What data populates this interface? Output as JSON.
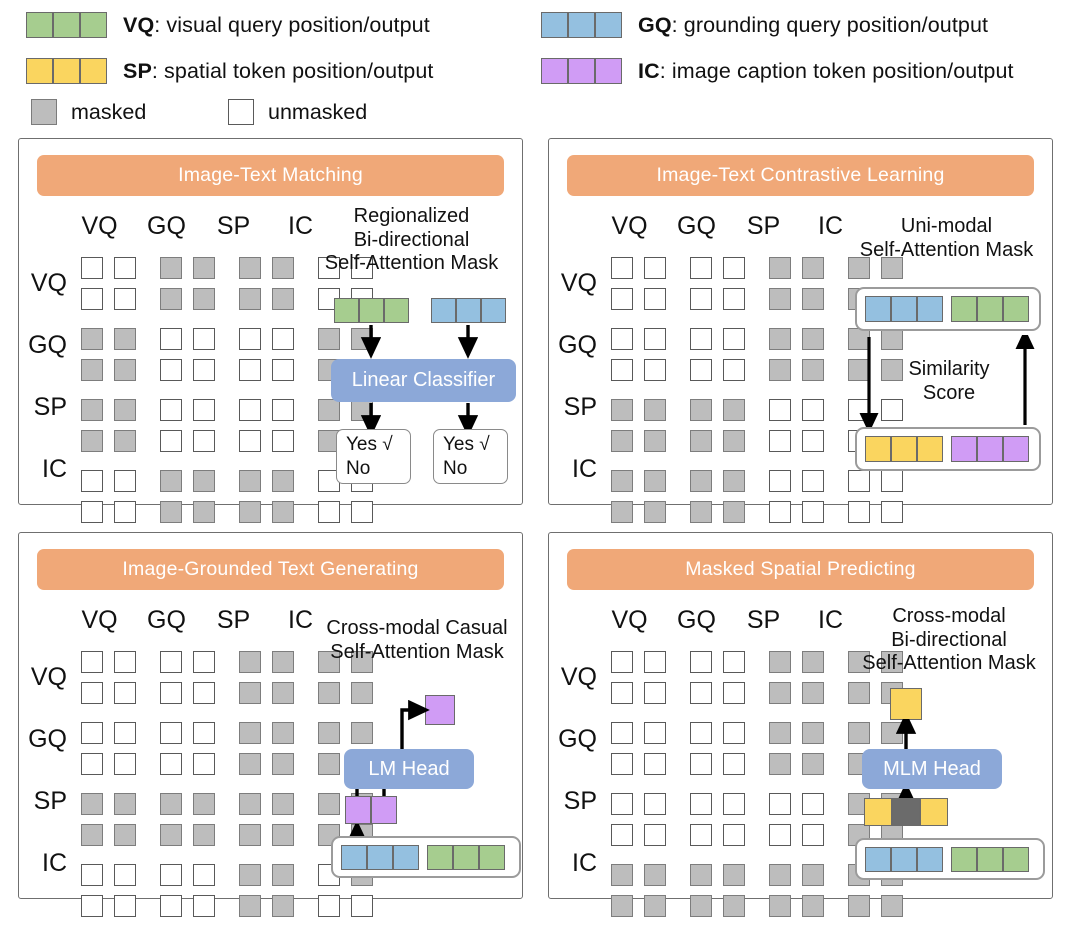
{
  "legend": {
    "entries": [
      {
        "code": "VQ",
        "desc": ": visual query position/output",
        "color": "#a6cd8f"
      },
      {
        "code": "GQ",
        "desc": ": grounding query position/output",
        "color": "#94c0e0"
      },
      {
        "code": "SP",
        "desc": ": spatial token position/output",
        "color": "#fad55f"
      },
      {
        "code": "IC",
        "desc": ": image caption token position/output",
        "color": "#d09cf5"
      }
    ],
    "masked_label": "masked",
    "unmasked_label": "unmasked"
  },
  "colors": {
    "vq_green": "#a6cd8f",
    "gq_blue": "#94c0e0",
    "sp_yellow": "#fad55f",
    "ic_purple": "#d09cf5",
    "banner_orange": "#f0a878",
    "head_blue": "#8ca8d8",
    "masked_gray": "#bdbdbd",
    "mask_token_dark": "#6b6b6b"
  },
  "axis": {
    "col_headers": [
      "VQ",
      "GQ",
      "SP",
      "IC"
    ],
    "row_labels": [
      "VQ",
      "GQ",
      "SP",
      "IC"
    ]
  },
  "panels": [
    {
      "id": "image-text-matching",
      "title": "Image-Text Matching",
      "caption": "Regionalized\nBi-directional\nSelf-Attention Mask",
      "caption_lines": [
        "Regionalized",
        "Bi-directional",
        "Self-Attention Mask"
      ],
      "mask": [
        [
          "u",
          "u",
          "m",
          "m",
          "m",
          "m",
          "u",
          "u"
        ],
        [
          "u",
          "u",
          "m",
          "m",
          "m",
          "m",
          "u",
          "u"
        ],
        [
          "m",
          "m",
          "u",
          "u",
          "u",
          "u",
          "m",
          "m"
        ],
        [
          "m",
          "m",
          "u",
          "u",
          "u",
          "u",
          "m",
          "m"
        ],
        [
          "m",
          "m",
          "u",
          "u",
          "u",
          "u",
          "m",
          "m"
        ],
        [
          "m",
          "m",
          "u",
          "u",
          "u",
          "u",
          "m",
          "m"
        ],
        [
          "u",
          "u",
          "m",
          "m",
          "m",
          "m",
          "u",
          "u"
        ],
        [
          "u",
          "u",
          "m",
          "m",
          "m",
          "m",
          "u",
          "u"
        ]
      ],
      "diagram": {
        "strip_left_color": "#a6cd8f",
        "strip_right_color": "#94c0e0",
        "head_label": "Linear Classifier",
        "out_left": [
          "Yes √",
          "No"
        ],
        "out_right": [
          "Yes √",
          "No"
        ]
      }
    },
    {
      "id": "image-text-contrastive-learning",
      "title": "Image-Text Contrastive Learning",
      "caption_lines": [
        "Uni-modal",
        "Self-Attention Mask"
      ],
      "mask": [
        [
          "u",
          "u",
          "u",
          "u",
          "m",
          "m",
          "m",
          "m"
        ],
        [
          "u",
          "u",
          "u",
          "u",
          "m",
          "m",
          "m",
          "m"
        ],
        [
          "u",
          "u",
          "u",
          "u",
          "m",
          "m",
          "m",
          "m"
        ],
        [
          "u",
          "u",
          "u",
          "u",
          "m",
          "m",
          "m",
          "m"
        ],
        [
          "m",
          "m",
          "m",
          "m",
          "u",
          "u",
          "u",
          "u"
        ],
        [
          "m",
          "m",
          "m",
          "m",
          "u",
          "u",
          "u",
          "u"
        ],
        [
          "m",
          "m",
          "m",
          "m",
          "u",
          "u",
          "u",
          "u"
        ],
        [
          "m",
          "m",
          "m",
          "m",
          "u",
          "u",
          "u",
          "u"
        ]
      ],
      "diagram": {
        "top_strip": [
          {
            "color": "#94c0e0",
            "n": 3
          },
          {
            "color": "#a6cd8f",
            "n": 3
          }
        ],
        "bottom_strip": [
          {
            "color": "#fad55f",
            "n": 3
          },
          {
            "color": "#d09cf5",
            "n": 3
          }
        ],
        "middle_label_lines": [
          "Similarity",
          "Score"
        ]
      }
    },
    {
      "id": "image-grounded-text-generating",
      "title": "Image-Grounded Text Generating",
      "caption_lines": [
        "Cross-modal Casual",
        "Self-Attention Mask"
      ],
      "mask": [
        [
          "u",
          "u",
          "u",
          "u",
          "m",
          "m",
          "m",
          "m"
        ],
        [
          "u",
          "u",
          "u",
          "u",
          "m",
          "m",
          "m",
          "m"
        ],
        [
          "u",
          "u",
          "u",
          "u",
          "m",
          "m",
          "m",
          "m"
        ],
        [
          "u",
          "u",
          "u",
          "u",
          "m",
          "m",
          "m",
          "m"
        ],
        [
          "m",
          "m",
          "m",
          "m",
          "m",
          "m",
          "m",
          "m"
        ],
        [
          "m",
          "m",
          "m",
          "m",
          "m",
          "m",
          "m",
          "m"
        ],
        [
          "u",
          "u",
          "u",
          "u",
          "m",
          "m",
          "u",
          "m"
        ],
        [
          "u",
          "u",
          "u",
          "u",
          "m",
          "m",
          "u",
          "u"
        ]
      ],
      "diagram": {
        "head_label": "LM Head",
        "out_token_color": "#d09cf5",
        "in_tokens": [
          {
            "color": "#d09cf5",
            "n": 2
          }
        ],
        "input_strip": [
          {
            "color": "#94c0e0",
            "n": 3
          },
          {
            "color": "#a6cd8f",
            "n": 3
          }
        ]
      }
    },
    {
      "id": "masked-spatial-predicting",
      "title": "Masked Spatial Predicting",
      "caption_lines": [
        "Cross-modal",
        "Bi-directional",
        "Self-Attention Mask"
      ],
      "mask": [
        [
          "u",
          "u",
          "u",
          "u",
          "m",
          "m",
          "m",
          "m"
        ],
        [
          "u",
          "u",
          "u",
          "u",
          "m",
          "m",
          "m",
          "m"
        ],
        [
          "u",
          "u",
          "u",
          "u",
          "m",
          "m",
          "m",
          "m"
        ],
        [
          "u",
          "u",
          "u",
          "u",
          "m",
          "m",
          "m",
          "m"
        ],
        [
          "u",
          "u",
          "u",
          "u",
          "u",
          "u",
          "m",
          "m"
        ],
        [
          "u",
          "u",
          "u",
          "u",
          "u",
          "u",
          "m",
          "m"
        ],
        [
          "m",
          "m",
          "m",
          "m",
          "m",
          "m",
          "m",
          "m"
        ],
        [
          "m",
          "m",
          "m",
          "m",
          "m",
          "m",
          "m",
          "m"
        ]
      ],
      "diagram": {
        "head_label": "MLM Head",
        "out_token_color": "#fad55f",
        "in_tokens": [
          {
            "color": "#fad55f",
            "n": 1
          },
          {
            "color": "#6b6b6b",
            "n": 1
          },
          {
            "color": "#fad55f",
            "n": 1
          }
        ],
        "input_strip": [
          {
            "color": "#94c0e0",
            "n": 3
          },
          {
            "color": "#a6cd8f",
            "n": 3
          }
        ]
      }
    }
  ]
}
